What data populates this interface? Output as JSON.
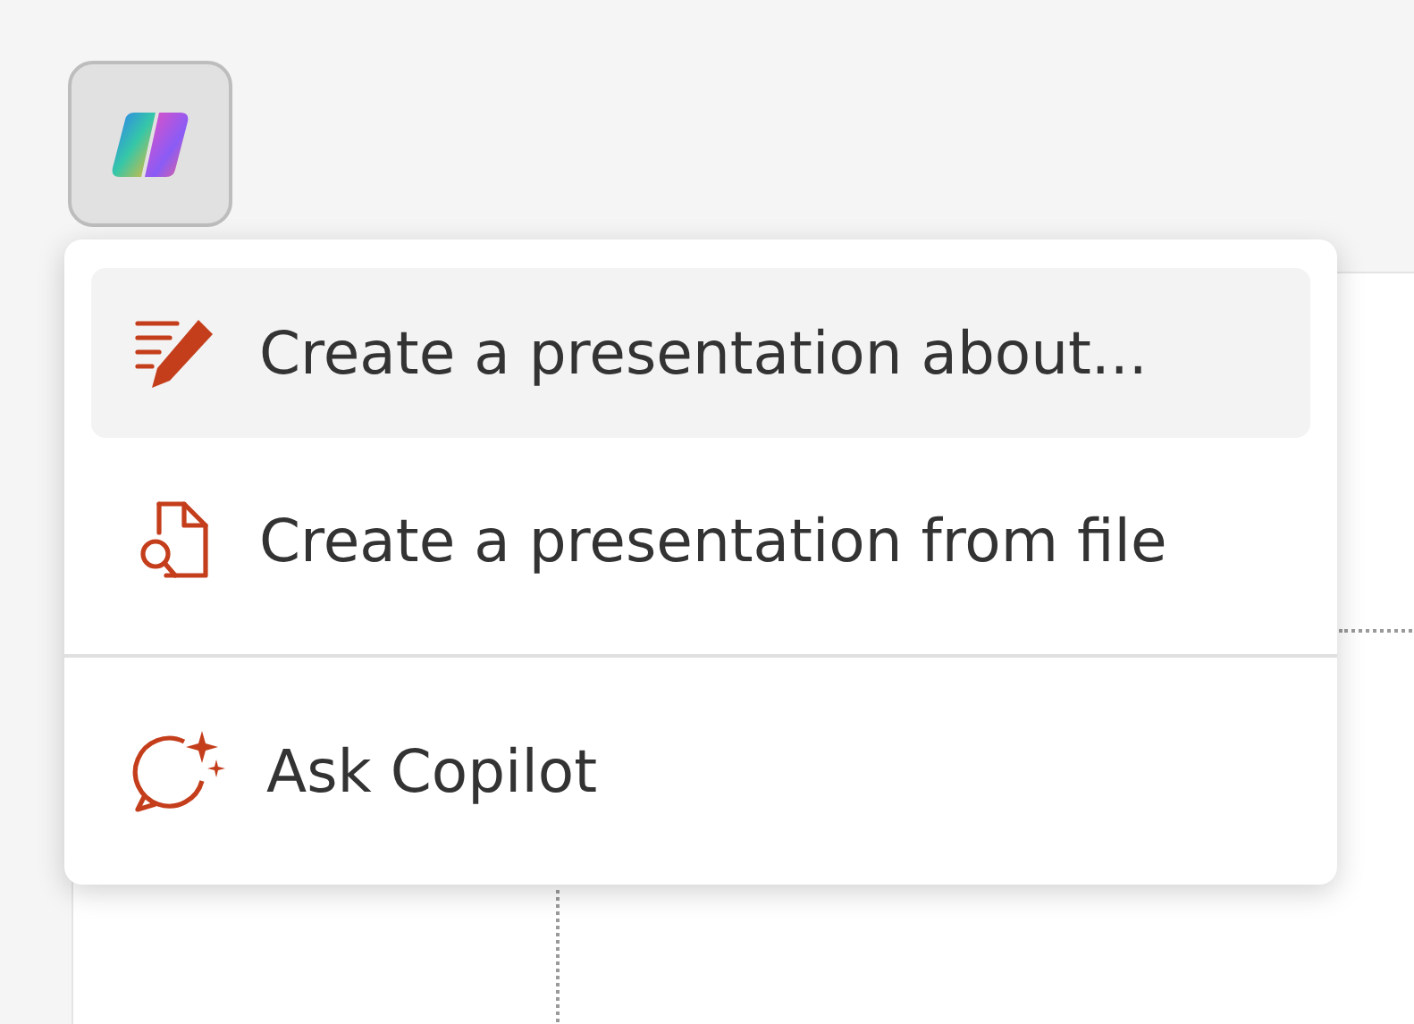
{
  "menu": {
    "groups": [
      [
        {
          "kind": "pen",
          "label": "Create a presentation about...",
          "selected": true
        },
        {
          "kind": "file-search",
          "label": "Create a presentation from file",
          "selected": false
        }
      ],
      [
        {
          "kind": "chat-sparkle",
          "label": "Ask Copilot",
          "selected": false
        }
      ]
    ]
  }
}
